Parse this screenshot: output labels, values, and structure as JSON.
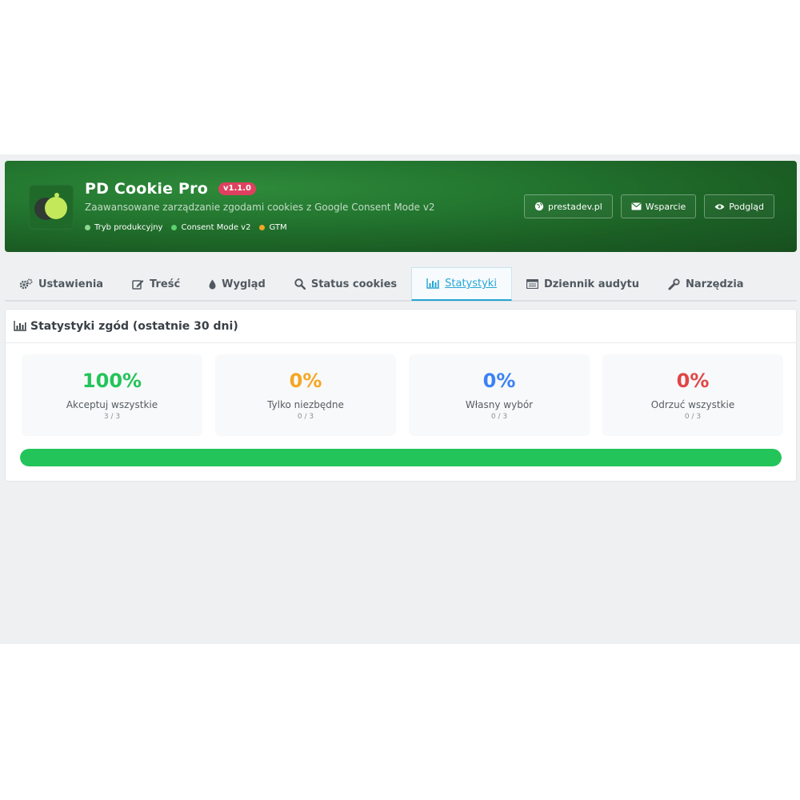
{
  "header": {
    "title": "PD Cookie Pro",
    "version": "v1.1.0",
    "subtitle": "Zaawansowane zarządzanie zgodami cookies z Google Consent Mode v2",
    "statuses": [
      {
        "label": "Tryb produkcyjny",
        "color": "#8fd48f"
      },
      {
        "label": "Consent Mode v2",
        "color": "#5fcf6f"
      },
      {
        "label": "GTM",
        "color": "#f5a623"
      }
    ],
    "buttons": [
      {
        "label": "prestadev.pl",
        "icon": "globe-icon"
      },
      {
        "label": "Wsparcie",
        "icon": "envelope-icon"
      },
      {
        "label": "Podgląd",
        "icon": "eye-icon"
      }
    ]
  },
  "tabs": [
    {
      "label": "Ustawienia",
      "icon": "gears-icon"
    },
    {
      "label": "Treść",
      "icon": "edit-icon"
    },
    {
      "label": "Wygląd",
      "icon": "tint-icon"
    },
    {
      "label": "Status cookies",
      "icon": "search-icon"
    },
    {
      "label": "Statystyki",
      "icon": "bar-chart-icon",
      "active": true
    },
    {
      "label": "Dziennik audytu",
      "icon": "list-icon"
    },
    {
      "label": "Narzędzia",
      "icon": "wrench-icon"
    }
  ],
  "stats": {
    "title": "Statystyki zgód (ostatnie 30 dni)",
    "cards": [
      {
        "value": "100%",
        "label": "Akceptuj wszystkie",
        "count": "3 / 3",
        "color": "#23c45a"
      },
      {
        "value": "0%",
        "label": "Tylko niezbędne",
        "count": "0 / 3",
        "color": "#f5a623"
      },
      {
        "value": "0%",
        "label": "Własny wybór",
        "count": "0 / 3",
        "color": "#3b82f6"
      },
      {
        "value": "0%",
        "label": "Odrzuć wszystkie",
        "count": "0 / 3",
        "color": "#e04646"
      }
    ],
    "progress_fraction": 1.0,
    "progress_color": "#23c45a"
  }
}
